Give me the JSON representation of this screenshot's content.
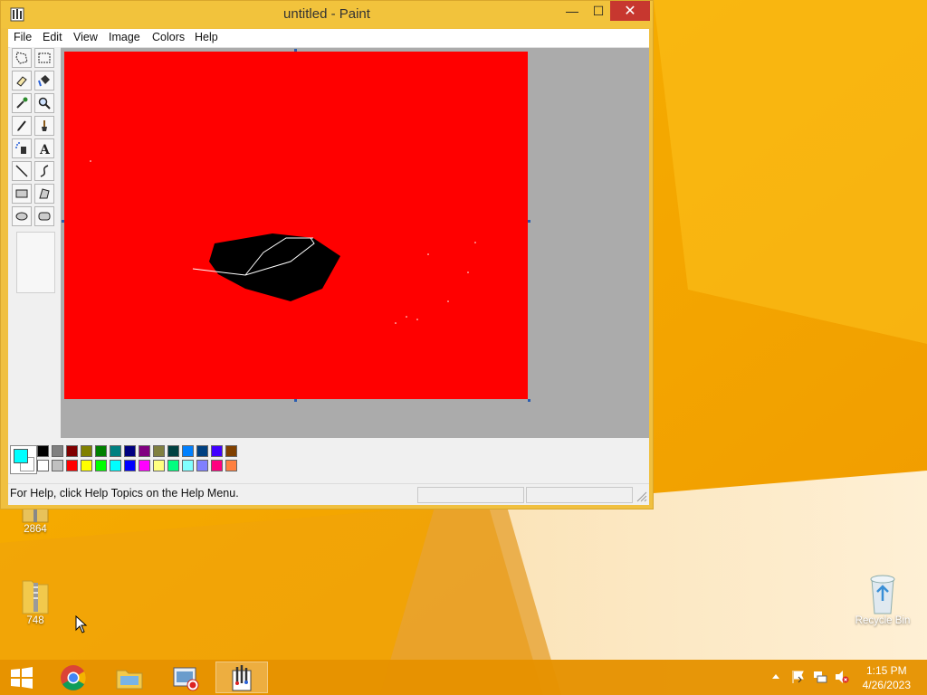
{
  "window": {
    "title": "untitled - Paint",
    "minimize_glyph": "—",
    "maximize_glyph": "☐",
    "close_glyph": "✕"
  },
  "menu": [
    "File",
    "Edit",
    "View",
    "Image",
    "Colors",
    "Help"
  ],
  "tools": [
    "free-form-select-icon",
    "select-icon",
    "eraser-icon",
    "fill-icon",
    "pick-color-icon",
    "magnifier-icon",
    "pencil-icon",
    "brush-icon",
    "airbrush-icon",
    "text-icon",
    "line-icon",
    "curve-icon",
    "rectangle-icon",
    "polygon-icon",
    "ellipse-icon",
    "rounded-rectangle-icon"
  ],
  "canvas": {
    "background_color": "#ff0000"
  },
  "palette": {
    "foreground": "#00ffff",
    "background": "#ffffff",
    "top_row": [
      "#000000",
      "#808080",
      "#800000",
      "#808000",
      "#008000",
      "#008080",
      "#000080",
      "#800080",
      "#808040",
      "#004040",
      "#0080ff",
      "#004080",
      "#4000ff",
      "#804000"
    ],
    "bottom_row": [
      "#ffffff",
      "#c0c0c0",
      "#ff0000",
      "#ffff00",
      "#00ff00",
      "#00ffff",
      "#0000ff",
      "#ff00ff",
      "#ffff80",
      "#00ff80",
      "#80ffff",
      "#8080ff",
      "#ff0080",
      "#ff8040"
    ]
  },
  "status": {
    "help_text": "For Help, click Help Topics on the Help Menu."
  },
  "desktop": {
    "icons": [
      {
        "label": "2864",
        "kind": "zip-folder-icon"
      },
      {
        "label": "748",
        "kind": "zip-folder-icon"
      },
      {
        "label": "Recycle Bin",
        "kind": "recycle-bin-icon"
      }
    ]
  },
  "taskbar": {
    "buttons": [
      "start-icon",
      "chrome-icon",
      "file-explorer-icon",
      "recorder-icon",
      "paint-icon"
    ],
    "clock_time": "1:15 PM",
    "clock_date": "4/26/2023"
  }
}
